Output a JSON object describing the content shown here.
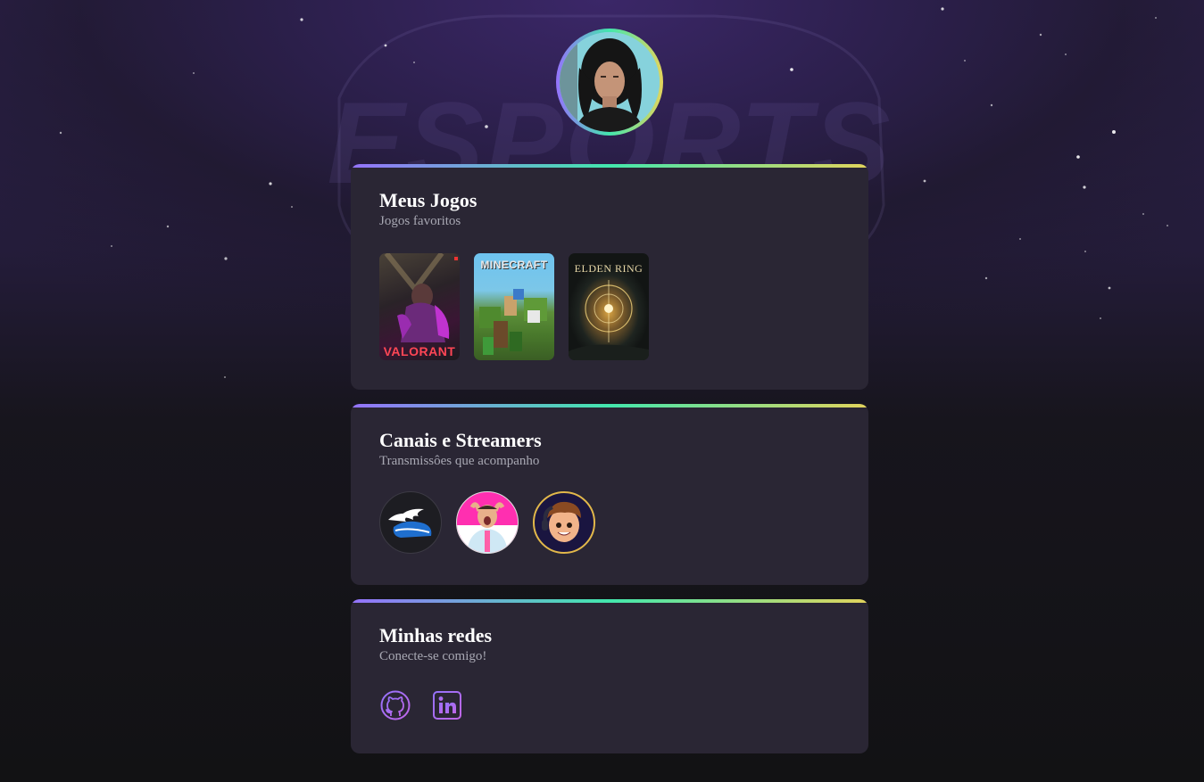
{
  "profile": {
    "avatar_alt": "Foto de perfil"
  },
  "background": {
    "watermark": "ESPORTS"
  },
  "games_card": {
    "title": "Meus Jogos",
    "subtitle": "Jogos favoritos",
    "games": [
      {
        "name": "VALORANT"
      },
      {
        "name": "MINECRAFT"
      },
      {
        "name": "ELDEN RING"
      }
    ]
  },
  "streamers_card": {
    "title": "Canais e Streamers",
    "subtitle": "Transmissôes que acompanho",
    "streamers": [
      {
        "icon": "winged-shoe-avatar"
      },
      {
        "icon": "surprised-man-avatar"
      },
      {
        "icon": "cartoon-gamer-avatar"
      }
    ]
  },
  "socials_card": {
    "title": "Minhas redes",
    "subtitle": "Conecte-se comigo!",
    "links": [
      {
        "icon": "github-icon"
      },
      {
        "icon": "linkedin-icon"
      }
    ]
  },
  "colors": {
    "gradient_start": "#9572fc",
    "gradient_mid": "#43e7ad",
    "gradient_end": "#e2d45c",
    "card_bg": "#2a2634",
    "page_bg": "#121214"
  }
}
